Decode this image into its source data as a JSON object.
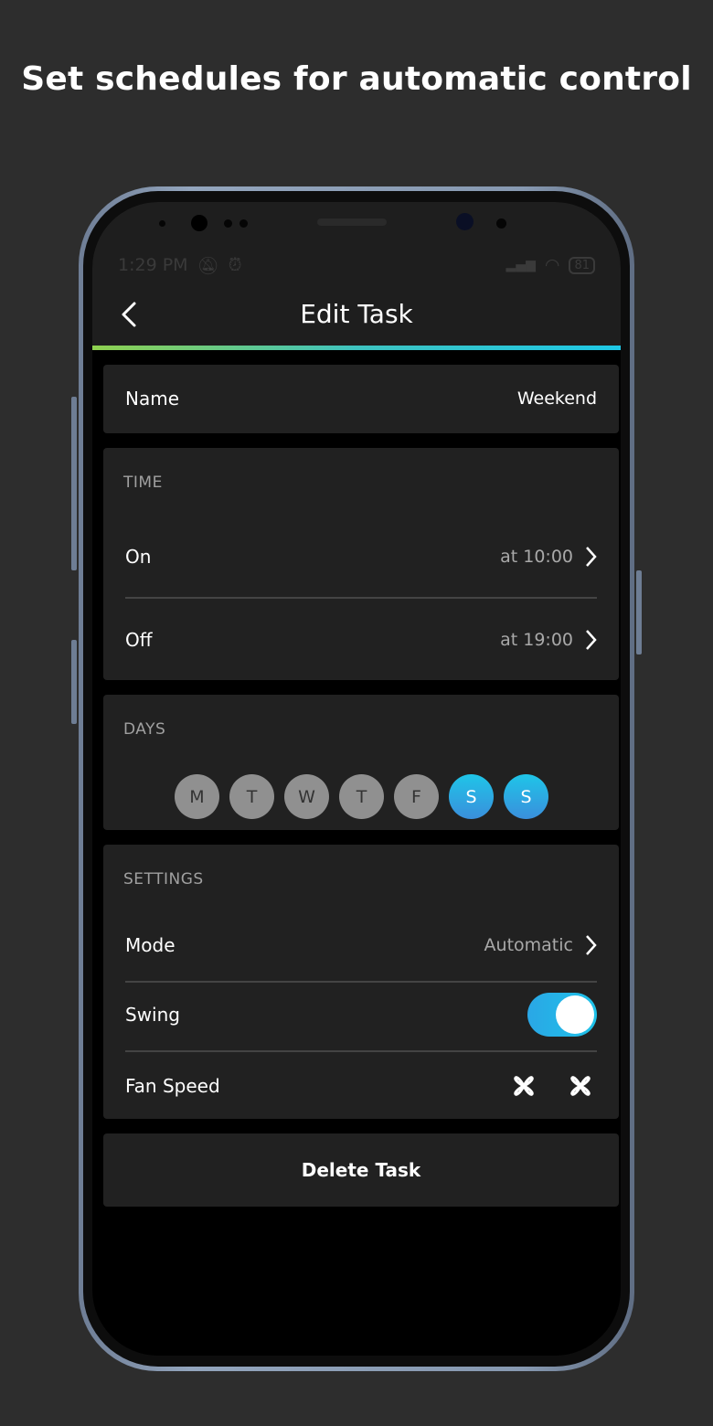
{
  "headline": "Set schedules for automatic control",
  "status": {
    "time": "1:29 PM",
    "battery": "81"
  },
  "header": {
    "title": "Edit Task"
  },
  "name_card": {
    "label": "Name",
    "value": "Weekend"
  },
  "time_card": {
    "section": "TIME",
    "on": {
      "label": "On",
      "value": "at 10:00"
    },
    "off": {
      "label": "Off",
      "value": "at 19:00"
    }
  },
  "days_card": {
    "section": "DAYS",
    "days": [
      {
        "letter": "M",
        "active": false
      },
      {
        "letter": "T",
        "active": false
      },
      {
        "letter": "W",
        "active": false
      },
      {
        "letter": "T",
        "active": false
      },
      {
        "letter": "F",
        "active": false
      },
      {
        "letter": "S",
        "active": true
      },
      {
        "letter": "S",
        "active": true
      }
    ]
  },
  "settings_card": {
    "section": "SETTINGS",
    "mode": {
      "label": "Mode",
      "value": "Automatic"
    },
    "swing": {
      "label": "Swing",
      "on": true
    },
    "fan": {
      "label": "Fan Speed"
    }
  },
  "delete_label": "Delete Task",
  "colors": {
    "accent_start": "#8fd14f",
    "accent_end": "#1ec8e6",
    "toggle": "#2aa7e6",
    "active_day": "#1fc5e8"
  }
}
